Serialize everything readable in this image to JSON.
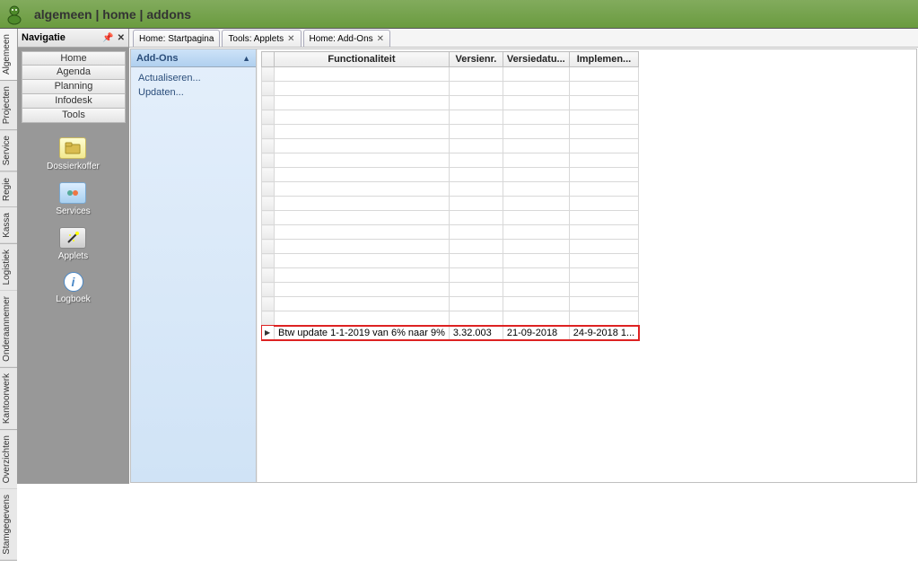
{
  "titlebar": {
    "title": "algemeen | home | addons"
  },
  "vtabs": [
    "Algemeen",
    "Projecten",
    "Service",
    "Regie",
    "Kassa",
    "Logistiek",
    "Onderaannemer",
    "Kantoorwerk",
    "Overzichten",
    "Stamgegevens"
  ],
  "nav": {
    "title": "Navigatie",
    "buttons": [
      "Home",
      "Agenda",
      "Planning",
      "Infodesk",
      "Tools"
    ],
    "items": [
      {
        "icon": "folder",
        "label": "Dossierkoffer"
      },
      {
        "icon": "blue",
        "label": "Services"
      },
      {
        "icon": "wand",
        "label": "Applets"
      },
      {
        "icon": "info",
        "label": "Logboek"
      }
    ]
  },
  "tabs": [
    {
      "label": "Home: Startpagina",
      "closable": false
    },
    {
      "label": "Tools: Applets",
      "closable": true
    },
    {
      "label": "Home: Add-Ons",
      "closable": true
    }
  ],
  "addons": {
    "title": "Add-Ons",
    "links": [
      "Actualiseren...",
      "Updaten..."
    ]
  },
  "grid": {
    "headers": [
      "Functionaliteit",
      "Versienr.",
      "Versiedatu...",
      "Implemen..."
    ],
    "empty_rows": 18,
    "row": {
      "func": "Btw update 1-1-2019 van 6% naar 9%",
      "ver": "3.32.003",
      "date": "21-09-2018",
      "imp": "24-9-2018 1..."
    }
  }
}
